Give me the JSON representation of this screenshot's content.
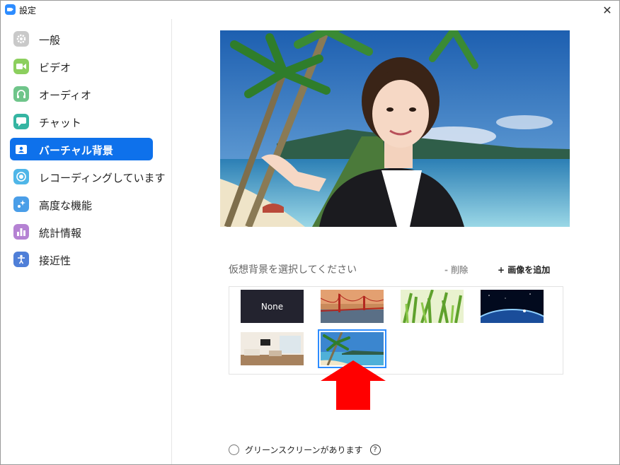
{
  "window": {
    "title": "設定",
    "close_glyph": "✕"
  },
  "sidebar": {
    "items": [
      {
        "label": "一般",
        "icon": "gear-icon",
        "color": "#c9c9c9",
        "active": false
      },
      {
        "label": "ビデオ",
        "icon": "video-icon",
        "color": "#8ccf5e",
        "active": false
      },
      {
        "label": "オーディオ",
        "icon": "headphones-icon",
        "color": "#6fc58a",
        "active": false
      },
      {
        "label": "チャット",
        "icon": "chat-icon",
        "color": "#35b5a2",
        "active": false
      },
      {
        "label": "バーチャル背景",
        "icon": "person-card-icon",
        "color": "#0E71EB",
        "active": true
      },
      {
        "label": "レコーディングしています",
        "icon": "record-icon",
        "color": "#4fb6e8",
        "active": false
      },
      {
        "label": "高度な機能",
        "icon": "sparkle-icon",
        "color": "#4a9ee8",
        "active": false
      },
      {
        "label": "統計情報",
        "icon": "bar-chart-icon",
        "color": "#b582d3",
        "active": false
      },
      {
        "label": "接近性",
        "icon": "accessibility-icon",
        "color": "#4f7fd8",
        "active": false
      }
    ]
  },
  "virtual_background": {
    "prompt": "仮想背景を選択してください",
    "delete_label": "- 削除",
    "add_label": "+ 画像を追加",
    "thumbnails": [
      {
        "label": "None",
        "kind": "none",
        "selected": false
      },
      {
        "label": "",
        "kind": "golden-gate-bridge",
        "selected": false
      },
      {
        "label": "",
        "kind": "grass",
        "selected": false
      },
      {
        "label": "",
        "kind": "earth-space",
        "selected": false
      },
      {
        "label": "",
        "kind": "living-room",
        "selected": false
      },
      {
        "label": "",
        "kind": "beach",
        "selected": true
      }
    ]
  },
  "green_screen": {
    "label": "グリーンスクリーンがあります",
    "checked": false,
    "help_glyph": "?"
  },
  "colors": {
    "accent": "#0E71EB",
    "selection_outline": "#2D8CFF",
    "arrow": "#ff0000"
  }
}
